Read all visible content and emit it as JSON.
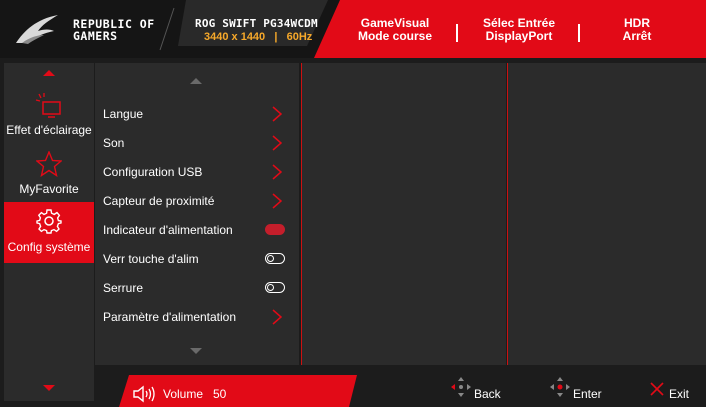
{
  "header": {
    "brand_line1": "REPUBLIC OF",
    "brand_line2": "GAMERS",
    "model": "ROG SWIFT PG34WCDM",
    "resolution": "3440 x 1440",
    "refresh": "60Hz",
    "info": [
      {
        "title": "GameVisual",
        "value": "Mode course"
      },
      {
        "title": "Sélec Entrée",
        "value": "DisplayPort"
      },
      {
        "title": "HDR",
        "value": "Arrêt"
      }
    ]
  },
  "nav": {
    "items": [
      {
        "label": "Effet d'éclairage",
        "icon": "lighting-icon",
        "active": false
      },
      {
        "label": "MyFavorite",
        "icon": "star-icon",
        "active": false
      },
      {
        "label": "Config système",
        "icon": "gear-icon",
        "active": true
      }
    ]
  },
  "menu": {
    "items": [
      {
        "label": "Langue",
        "control": "chevron"
      },
      {
        "label": "Son",
        "control": "chevron"
      },
      {
        "label": "Configuration USB",
        "control": "chevron"
      },
      {
        "label": "Capteur de proximité",
        "control": "chevron"
      },
      {
        "label": "Indicateur d'alimentation",
        "control": "toggle-on"
      },
      {
        "label": "Verr touche d'alim",
        "control": "toggle-off"
      },
      {
        "label": "Serrure",
        "control": "toggle-off"
      },
      {
        "label": "Paramètre d'alimentation",
        "control": "chevron"
      }
    ]
  },
  "footer": {
    "volume_label": "Volume",
    "volume_value": "50",
    "back_label": "Back",
    "enter_label": "Enter",
    "exit_label": "Exit"
  },
  "colors": {
    "accent": "#e20a17",
    "panel": "#2b2b2b",
    "frame": "#1c1c1c",
    "model_sub": "#f7a92a"
  }
}
